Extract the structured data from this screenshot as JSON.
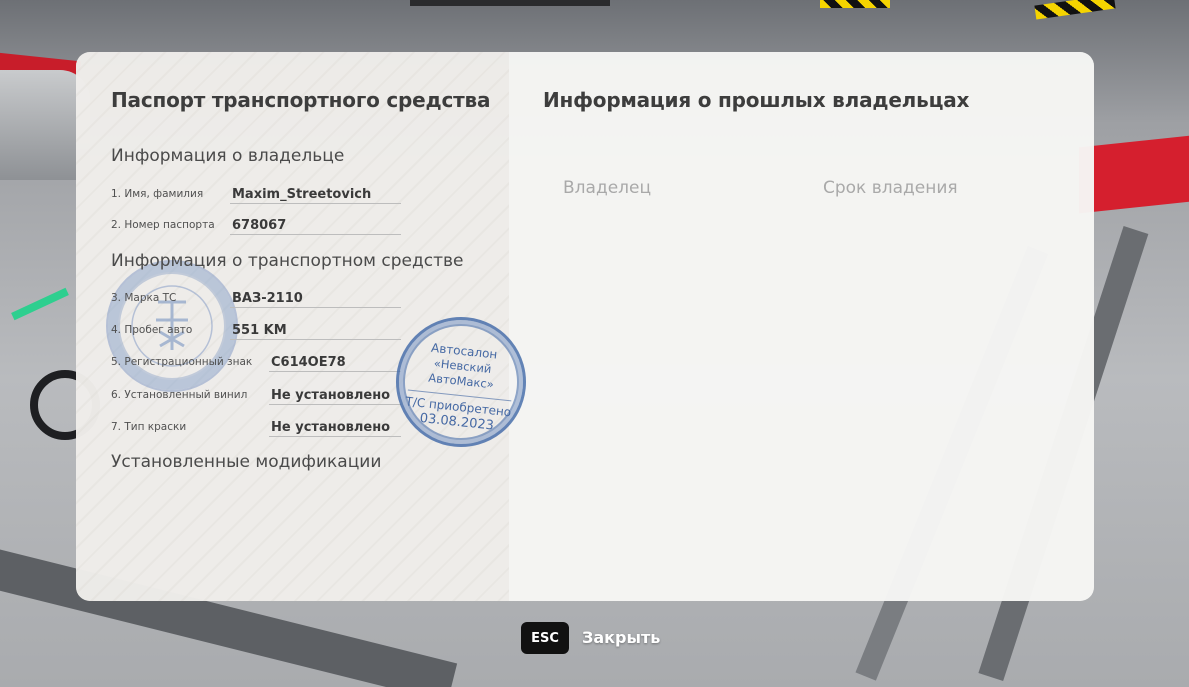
{
  "passport": {
    "title": "Паспорт транспортного средства",
    "owner_section": "Информация о владельце",
    "owner_fields": [
      {
        "label": "1. Имя, фамилия",
        "value": "Maxim_Streetovich"
      },
      {
        "label": "2. Номер паспорта",
        "value": "678067"
      }
    ],
    "vehicle_section": "Информация о транспортном средстве",
    "vehicle_fields": [
      {
        "label": "3. Марка ТС",
        "value": "ВАЗ-2110"
      },
      {
        "label": "4. Пробег авто",
        "value": "551 KM"
      },
      {
        "label": "5. Регистрационный знак",
        "value": "С614ОЕ78"
      },
      {
        "label": "6. Установленный винил",
        "value": "Не установлено"
      },
      {
        "label": "7. Тип краски",
        "value": "Не установлено"
      }
    ],
    "mods_section": "Установленные модификации"
  },
  "previous_owners": {
    "title": "Информация о прошлых владельцах",
    "col_owner": "Владелец",
    "col_period": "Срок владения"
  },
  "stamp": {
    "line1": "Автосалон",
    "line2": "«Невский АвтоМакс»",
    "line3": "Т/С приобретено",
    "line4": "03.08.2023",
    "color": "#3c62a0"
  },
  "footer": {
    "esc_key": "ESC",
    "close_label": "Закрыть"
  }
}
